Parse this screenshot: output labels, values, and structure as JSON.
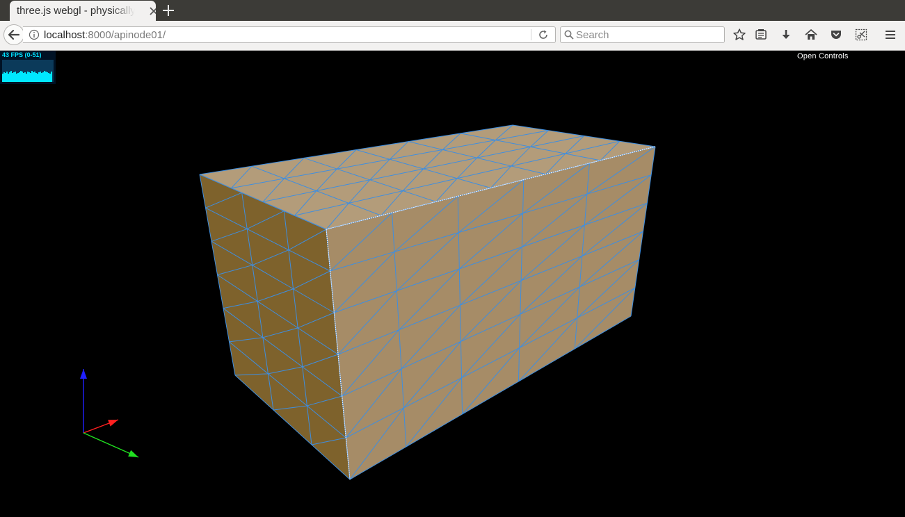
{
  "tab": {
    "title": "three.js webgl - physically based"
  },
  "address": {
    "host": "localhost",
    "rest": ":8000/apinode01/"
  },
  "search": {
    "placeholder": "Search"
  },
  "overlay": {
    "fps_label": "43 FPS (0-51)",
    "controls_label": "Open Controls"
  },
  "colors": {
    "mesh_top": "#b39c7a",
    "mesh_front": "#a68c67",
    "mesh_left": "#7e622c",
    "wireframe": "#3e8ee0",
    "axis_x": "#ff2020",
    "axis_y": "#20e020",
    "axis_z": "#2020ff"
  },
  "icons": [
    "back-arrow-icon",
    "info-icon",
    "reload-icon",
    "search-icon",
    "bookmark-star-icon",
    "reading-list-icon",
    "download-icon",
    "home-icon",
    "pocket-icon",
    "screenshot-icon",
    "menu-icon",
    "close-icon",
    "plus-icon"
  ]
}
